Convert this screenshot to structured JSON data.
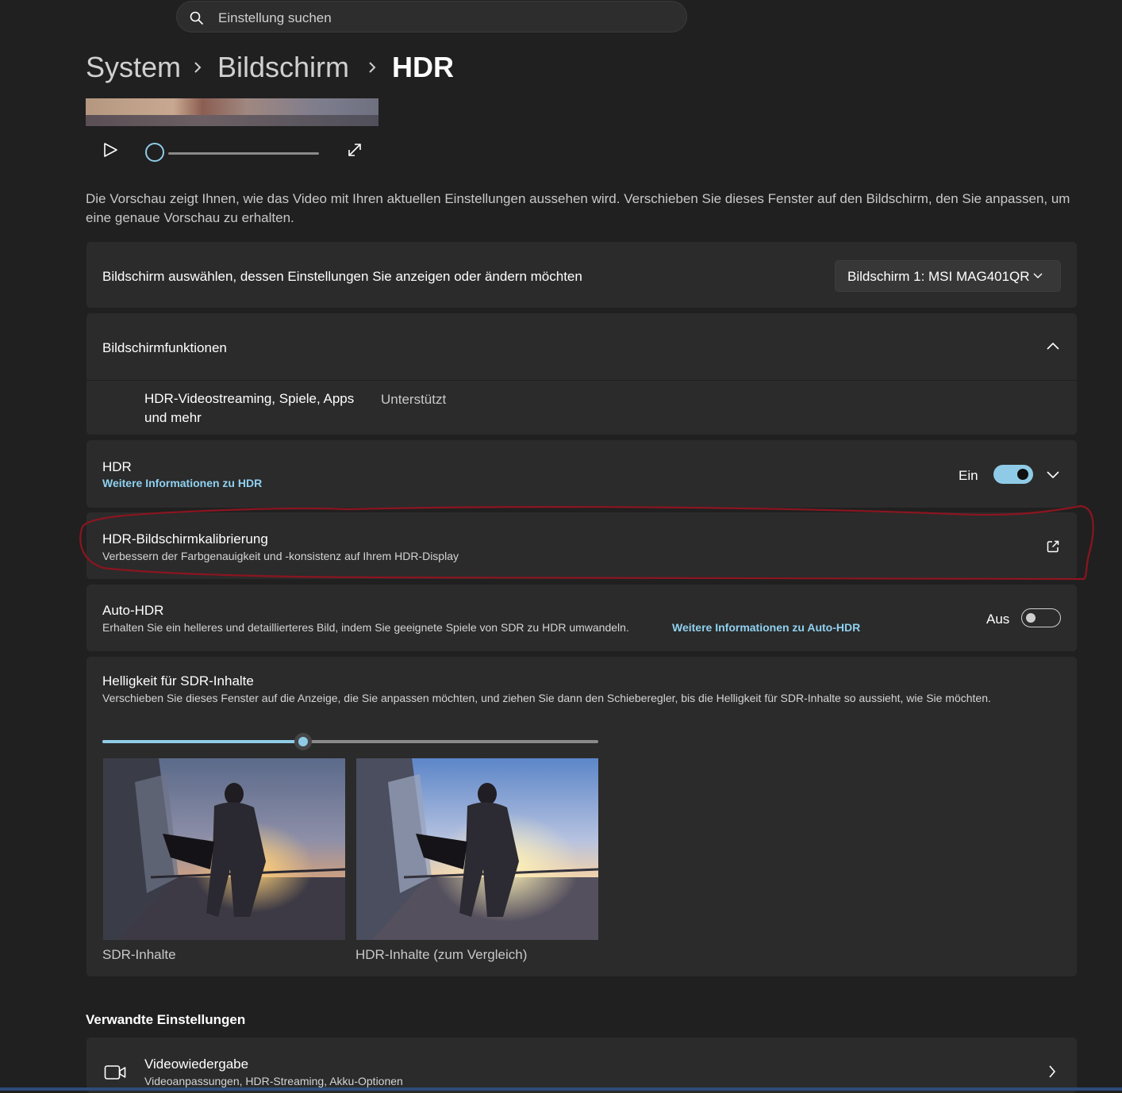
{
  "search": {
    "placeholder": "Einstellung suchen"
  },
  "breadcrumb": {
    "items": [
      "System",
      "Bildschirm"
    ],
    "current": "HDR"
  },
  "preview": {
    "description": "Die Vorschau zeigt Ihnen, wie das Video mit Ihren aktuellen Einstellungen aussehen wird. Verschieben Sie dieses Fenster auf den Bildschirm, den Sie anpassen, um eine genaue Vorschau zu erhalten.",
    "progress": 0
  },
  "display_select": {
    "label": "Bildschirm auswählen, dessen Einstellungen Sie anzeigen oder ändern möchten",
    "selected": "Bildschirm 1: MSI MAG401QR"
  },
  "capabilities": {
    "title": "Bildschirmfunktionen",
    "feature_line1": "HDR-Videostreaming, Spiele, Apps",
    "feature_line2": "und mehr",
    "status": "Unterstützt"
  },
  "hdr": {
    "title": "HDR",
    "link": "Weitere Informationen zu HDR",
    "state_label": "Ein",
    "enabled": true
  },
  "calibration": {
    "title": "HDR-Bildschirmkalibrierung",
    "subtitle": "Verbessern der Farbgenauigkeit und -konsistenz auf Ihrem HDR-Display"
  },
  "auto_hdr": {
    "title": "Auto-HDR",
    "subtitle": "Erhalten Sie ein helleres und detaillierteres Bild, indem Sie geeignete Spiele von SDR zu HDR umwandeln.",
    "link": "Weitere Informationen zu Auto-HDR",
    "state_label": "Aus",
    "enabled": false
  },
  "sdr_brightness": {
    "title": "Helligkeit für SDR-Inhalte",
    "subtitle": "Verschieben Sie dieses Fenster auf die Anzeige, die Sie anpassen möchten, und ziehen Sie dann den Schieberegler, bis die Helligkeit für SDR-Inhalte so aussieht, wie Sie möchten.",
    "value_fraction": 0.405,
    "left_caption": "SDR-Inhalte",
    "right_caption": "HDR-Inhalte (zum Vergleich)"
  },
  "related": {
    "title": "Verwandte Einstellungen",
    "video_playback": {
      "title": "Videowiedergabe",
      "subtitle": "Videoanpassungen, HDR-Streaming, Akku-Optionen"
    }
  },
  "colors": {
    "accent": "#8fcbe6",
    "link": "#8fd1f0",
    "background": "#202020",
    "card": "#2b2b2b",
    "annotation": "#8b1520"
  },
  "icons": [
    "search-icon",
    "chevron-right-icon",
    "play-icon",
    "expand-icon",
    "chevron-down-icon",
    "chevron-up-icon",
    "external-link-icon",
    "video-camera-icon"
  ]
}
